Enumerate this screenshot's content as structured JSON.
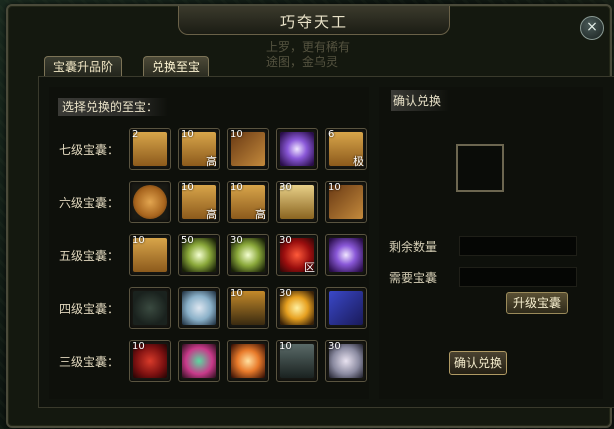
{
  "window": {
    "title": "巧夺天工",
    "close_label": "×"
  },
  "tabs": [
    {
      "label": "宝囊升品阶",
      "active": false
    },
    {
      "label": "兑换至宝",
      "active": true
    }
  ],
  "background_fragment": {
    "line1": "上罗，更有稀有",
    "line2": "途图，金乌灵"
  },
  "left": {
    "heading": "选择兑换的至宝：",
    "rows": [
      {
        "label": "七级宝囊：",
        "items": [
          {
            "icon": "scroll-icon",
            "count": "2",
            "tag": ""
          },
          {
            "icon": "scroll-icon",
            "count": "10",
            "tag": "高"
          },
          {
            "icon": "book-icon",
            "count": "10",
            "tag": ""
          },
          {
            "icon": "purple-orb-icon",
            "count": "",
            "tag": ""
          },
          {
            "icon": "scroll-icon",
            "count": "6",
            "tag": "极"
          }
        ]
      },
      {
        "label": "六级宝囊：",
        "items": [
          {
            "icon": "shell-icon",
            "count": "",
            "tag": ""
          },
          {
            "icon": "scroll-icon",
            "count": "10",
            "tag": "高"
          },
          {
            "icon": "scroll-icon",
            "count": "10",
            "tag": "高"
          },
          {
            "icon": "pillow-icon",
            "count": "30",
            "tag": ""
          },
          {
            "icon": "book-icon",
            "count": "10",
            "tag": ""
          }
        ]
      },
      {
        "label": "五级宝囊：",
        "items": [
          {
            "icon": "scroll-icon",
            "count": "10",
            "tag": ""
          },
          {
            "icon": "green-glow-icon",
            "count": "50",
            "tag": ""
          },
          {
            "icon": "green-glow-icon",
            "count": "30",
            "tag": ""
          },
          {
            "icon": "red-lantern-icon",
            "count": "30",
            "tag": "区"
          },
          {
            "icon": "purple-orb-icon",
            "count": "",
            "tag": ""
          }
        ]
      },
      {
        "label": "四级宝囊：",
        "items": [
          {
            "icon": "dark-bird-icon",
            "count": "",
            "tag": ""
          },
          {
            "icon": "vase-icon",
            "count": "",
            "tag": ""
          },
          {
            "icon": "incense-icon",
            "count": "10",
            "tag": ""
          },
          {
            "icon": "gold-orb-icon",
            "count": "30",
            "tag": ""
          },
          {
            "icon": "blue-chest-icon",
            "count": "",
            "tag": ""
          }
        ]
      },
      {
        "label": "三级宝囊：",
        "items": [
          {
            "icon": "sack-icon",
            "count": "10",
            "tag": ""
          },
          {
            "icon": "globe-icon",
            "count": "",
            "tag": ""
          },
          {
            "icon": "flame-icon",
            "count": "",
            "tag": ""
          },
          {
            "icon": "statue-icon",
            "count": "10",
            "tag": ""
          },
          {
            "icon": "pot-icon",
            "count": "30",
            "tag": ""
          }
        ]
      }
    ]
  },
  "right": {
    "heading": "确认兑换",
    "remaining_label": "剩余数量",
    "remaining_value": "",
    "required_label": "需要宝囊",
    "required_value": "",
    "upgrade_button": "升级宝囊",
    "confirm_button": "确认兑换"
  }
}
